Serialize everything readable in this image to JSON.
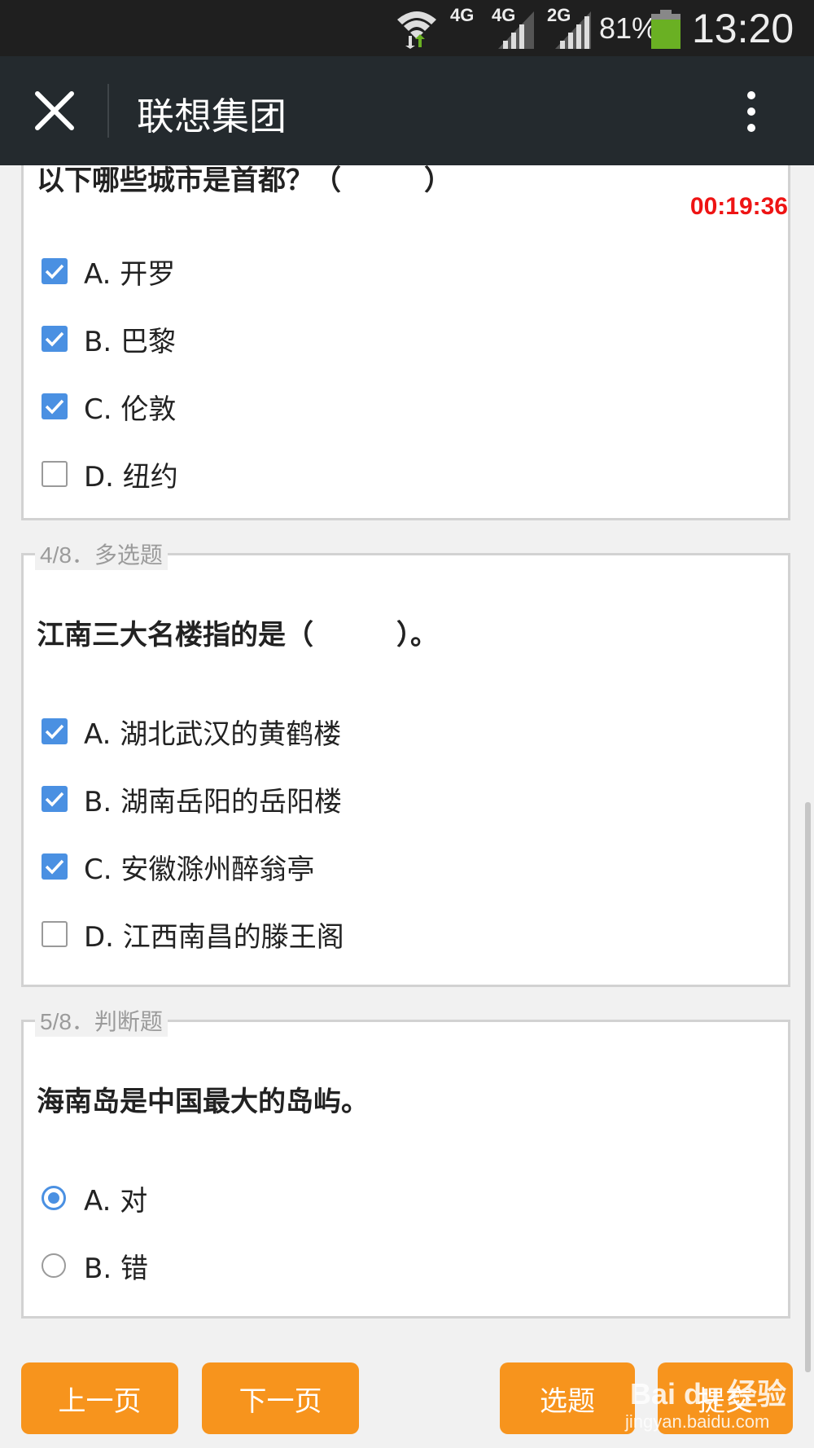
{
  "status_bar": {
    "net1": "4G",
    "net2": "4G",
    "net3": "2G",
    "battery": "81%",
    "time": "13:20",
    "battery_color": "#6ab023"
  },
  "header": {
    "title": "联想集团",
    "close_icon": "close-icon",
    "more_icon": "more-vertical-icon"
  },
  "timer": "00:19:36",
  "questions": [
    {
      "text": "以下哪些城市是首都？（　　　）",
      "options": [
        {
          "label": "A. 开罗",
          "checked": true
        },
        {
          "label": "B. 巴黎",
          "checked": true
        },
        {
          "label": "C. 伦敦",
          "checked": true
        },
        {
          "label": "D. 纽约",
          "checked": false
        }
      ]
    },
    {
      "legend": "4/8．多选题",
      "text": "江南三大名楼指的是（　　　）。",
      "options": [
        {
          "label": "A. 湖北武汉的黄鹤楼",
          "checked": true
        },
        {
          "label": "B. 湖南岳阳的岳阳楼",
          "checked": true
        },
        {
          "label": "C. 安徽滁州醉翁亭",
          "checked": true
        },
        {
          "label": "D. 江西南昌的滕王阁",
          "checked": false
        }
      ]
    },
    {
      "legend": "5/8．判断题",
      "text": "海南岛是中国最大的岛屿。",
      "options": [
        {
          "label": "A. 对",
          "checked": true
        },
        {
          "label": "B. 错",
          "checked": false
        }
      ]
    }
  ],
  "buttons": {
    "prev": "上一页",
    "next": "下一页",
    "select": "选题",
    "submit": "提交"
  },
  "watermark": {
    "brand": "Bai du 经验",
    "url": "jingyan.baidu.com"
  },
  "colors": {
    "accent_orange": "#f7941d",
    "check_blue": "#4a90e2",
    "timer_red": "#ee1414"
  }
}
